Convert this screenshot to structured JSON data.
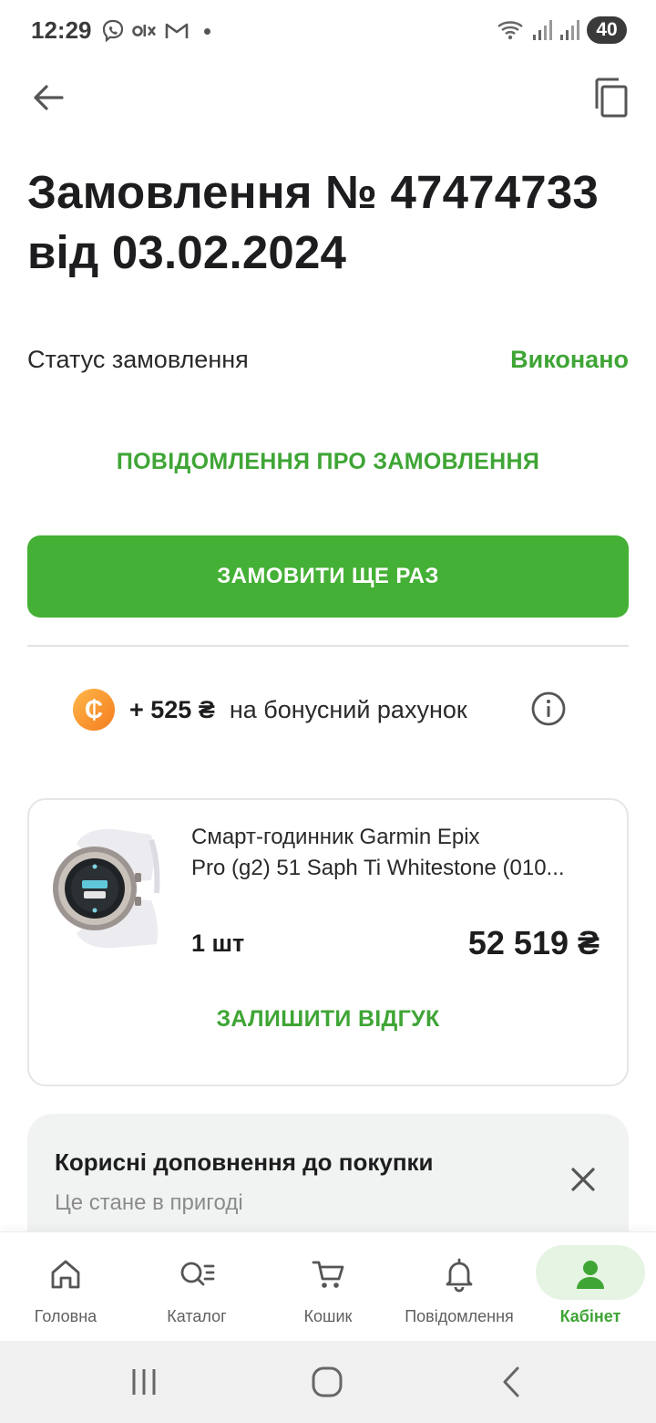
{
  "status_bar": {
    "time": "12:29",
    "battery": "40",
    "left_icons": [
      "viber-icon",
      "olx-icon",
      "gmail-icon",
      "dot-icon"
    ],
    "right_icons": [
      "wifi-icon",
      "signal-icon",
      "signal-icon",
      "battery-icon"
    ]
  },
  "header": {
    "back_icon": "arrow-left-icon",
    "copy_icon": "copy-icon",
    "title_line1": "Замовлення № 47474733",
    "title_line2": "від 03.02.2024"
  },
  "order_status": {
    "label": "Статус замовлення",
    "value": "Виконано"
  },
  "notifications_link": "ПОВІДОМЛЕННЯ ПРО ЗАМОВЛЕННЯ",
  "reorder_button": "ЗАМОВИТИ ЩЕ РАЗ",
  "bonus": {
    "coin_symbol": "₵",
    "amount": "+ 525 ₴",
    "text": "на бонусний рахунок",
    "info_icon": "info-icon"
  },
  "product": {
    "name_line1": "Смарт-годинник Garmin Epix",
    "name_line2": "Pro (g2) 51 Saph Ti Whitestone (010...",
    "quantity": "1 шт",
    "price": "52 519 ₴",
    "review_link": "ЗАЛИШИТИ ВІДГУК"
  },
  "addons": {
    "title": "Корисні доповнення до покупки",
    "subtitle": "Це стане в пригоді",
    "close_icon": "close-icon"
  },
  "bottom_nav": {
    "items": [
      {
        "label": "Головна",
        "icon": "home-icon"
      },
      {
        "label": "Каталог",
        "icon": "catalog-search-icon"
      },
      {
        "label": "Кошик",
        "icon": "cart-icon"
      },
      {
        "label": "Повідомлення",
        "icon": "bell-icon"
      },
      {
        "label": "Кабінет",
        "icon": "user-icon",
        "active": true
      }
    ]
  },
  "colors": {
    "accent_green": "#44b035",
    "accent_text_green": "#3fa535",
    "coin_orange": "#f47c1e"
  }
}
